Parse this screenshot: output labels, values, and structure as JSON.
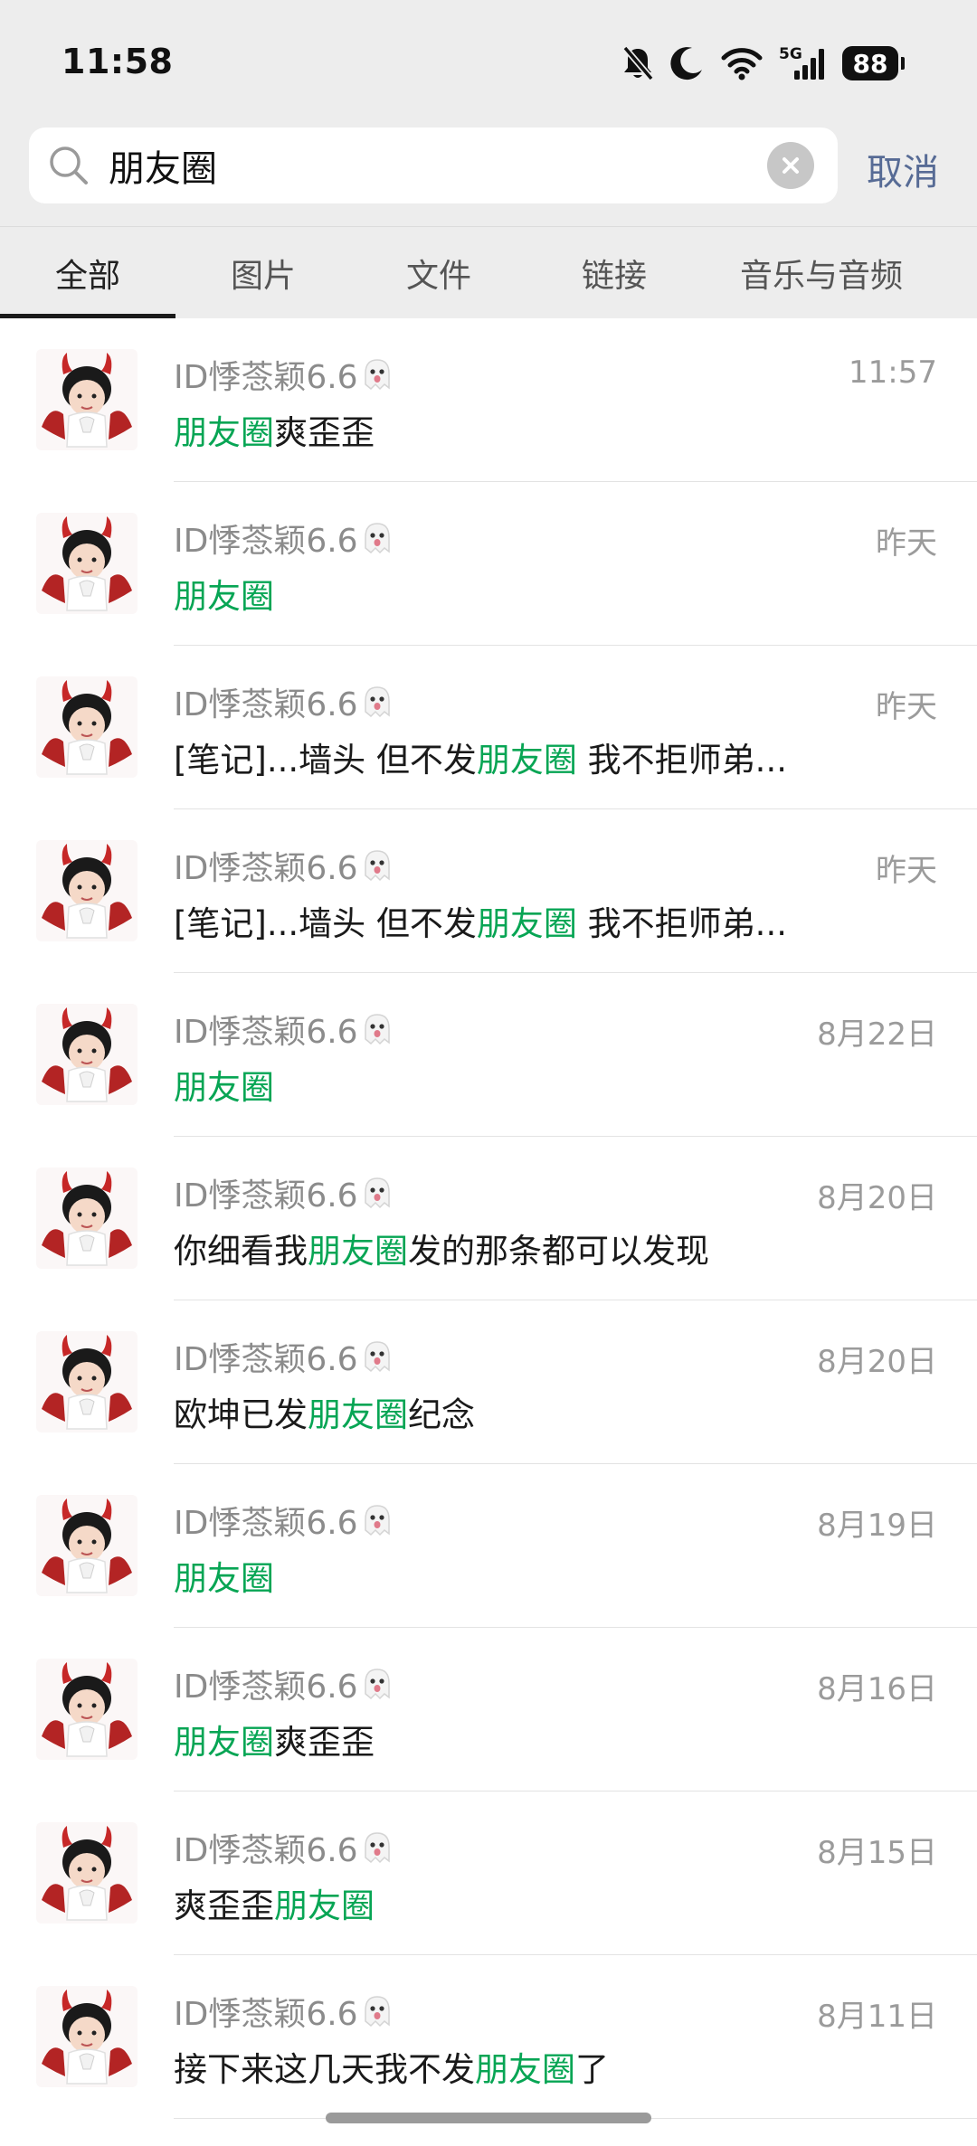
{
  "status_bar": {
    "time": "11:58",
    "network": "5G",
    "battery": "88"
  },
  "search": {
    "query": "朋友圈",
    "cancel_label": "取消"
  },
  "tabs": [
    {
      "label": "全部",
      "active": true
    },
    {
      "label": "图片",
      "active": false
    },
    {
      "label": "文件",
      "active": false
    },
    {
      "label": "链接",
      "active": false
    },
    {
      "label": "音乐与音频",
      "active": false
    }
  ],
  "colors": {
    "highlight": "#07a554",
    "cancel": "#576b95"
  },
  "results": [
    {
      "name": "ID悸菍颖6.6",
      "date": "11:57",
      "parts": [
        {
          "t": "朋友圈",
          "hl": true
        },
        {
          "t": "爽歪歪",
          "hl": false
        }
      ]
    },
    {
      "name": "ID悸菍颖6.6",
      "date": "昨天",
      "parts": [
        {
          "t": "朋友圈",
          "hl": true
        }
      ]
    },
    {
      "name": "ID悸菍颖6.6",
      "date": "昨天",
      "parts": [
        {
          "t": "[笔记]...墙头 但不发",
          "hl": false
        },
        {
          "t": "朋友圈",
          "hl": true
        },
        {
          "t": " 我不拒师弟...",
          "hl": false
        }
      ]
    },
    {
      "name": "ID悸菍颖6.6",
      "date": "昨天",
      "parts": [
        {
          "t": "[笔记]...墙头 但不发",
          "hl": false
        },
        {
          "t": "朋友圈",
          "hl": true
        },
        {
          "t": " 我不拒师弟...",
          "hl": false
        }
      ]
    },
    {
      "name": "ID悸菍颖6.6",
      "date": "8月22日",
      "parts": [
        {
          "t": "朋友圈",
          "hl": true
        }
      ]
    },
    {
      "name": "ID悸菍颖6.6",
      "date": "8月20日",
      "parts": [
        {
          "t": "你细看我",
          "hl": false
        },
        {
          "t": "朋友圈",
          "hl": true
        },
        {
          "t": "发的那条都可以发现",
          "hl": false
        }
      ]
    },
    {
      "name": "ID悸菍颖6.6",
      "date": "8月20日",
      "parts": [
        {
          "t": "欧坤已发",
          "hl": false
        },
        {
          "t": "朋友圈",
          "hl": true
        },
        {
          "t": "纪念",
          "hl": false
        }
      ]
    },
    {
      "name": "ID悸菍颖6.6",
      "date": "8月19日",
      "parts": [
        {
          "t": "朋友圈",
          "hl": true
        }
      ]
    },
    {
      "name": "ID悸菍颖6.6",
      "date": "8月16日",
      "parts": [
        {
          "t": "朋友圈",
          "hl": true
        },
        {
          "t": "爽歪歪",
          "hl": false
        }
      ]
    },
    {
      "name": "ID悸菍颖6.6",
      "date": "8月15日",
      "parts": [
        {
          "t": "爽歪歪",
          "hl": false
        },
        {
          "t": "朋友圈",
          "hl": true
        }
      ]
    },
    {
      "name": "ID悸菍颖6.6",
      "date": "8月11日",
      "parts": [
        {
          "t": "接下来这几天我不发",
          "hl": false
        },
        {
          "t": "朋友圈",
          "hl": true
        },
        {
          "t": "了",
          "hl": false
        }
      ]
    }
  ]
}
